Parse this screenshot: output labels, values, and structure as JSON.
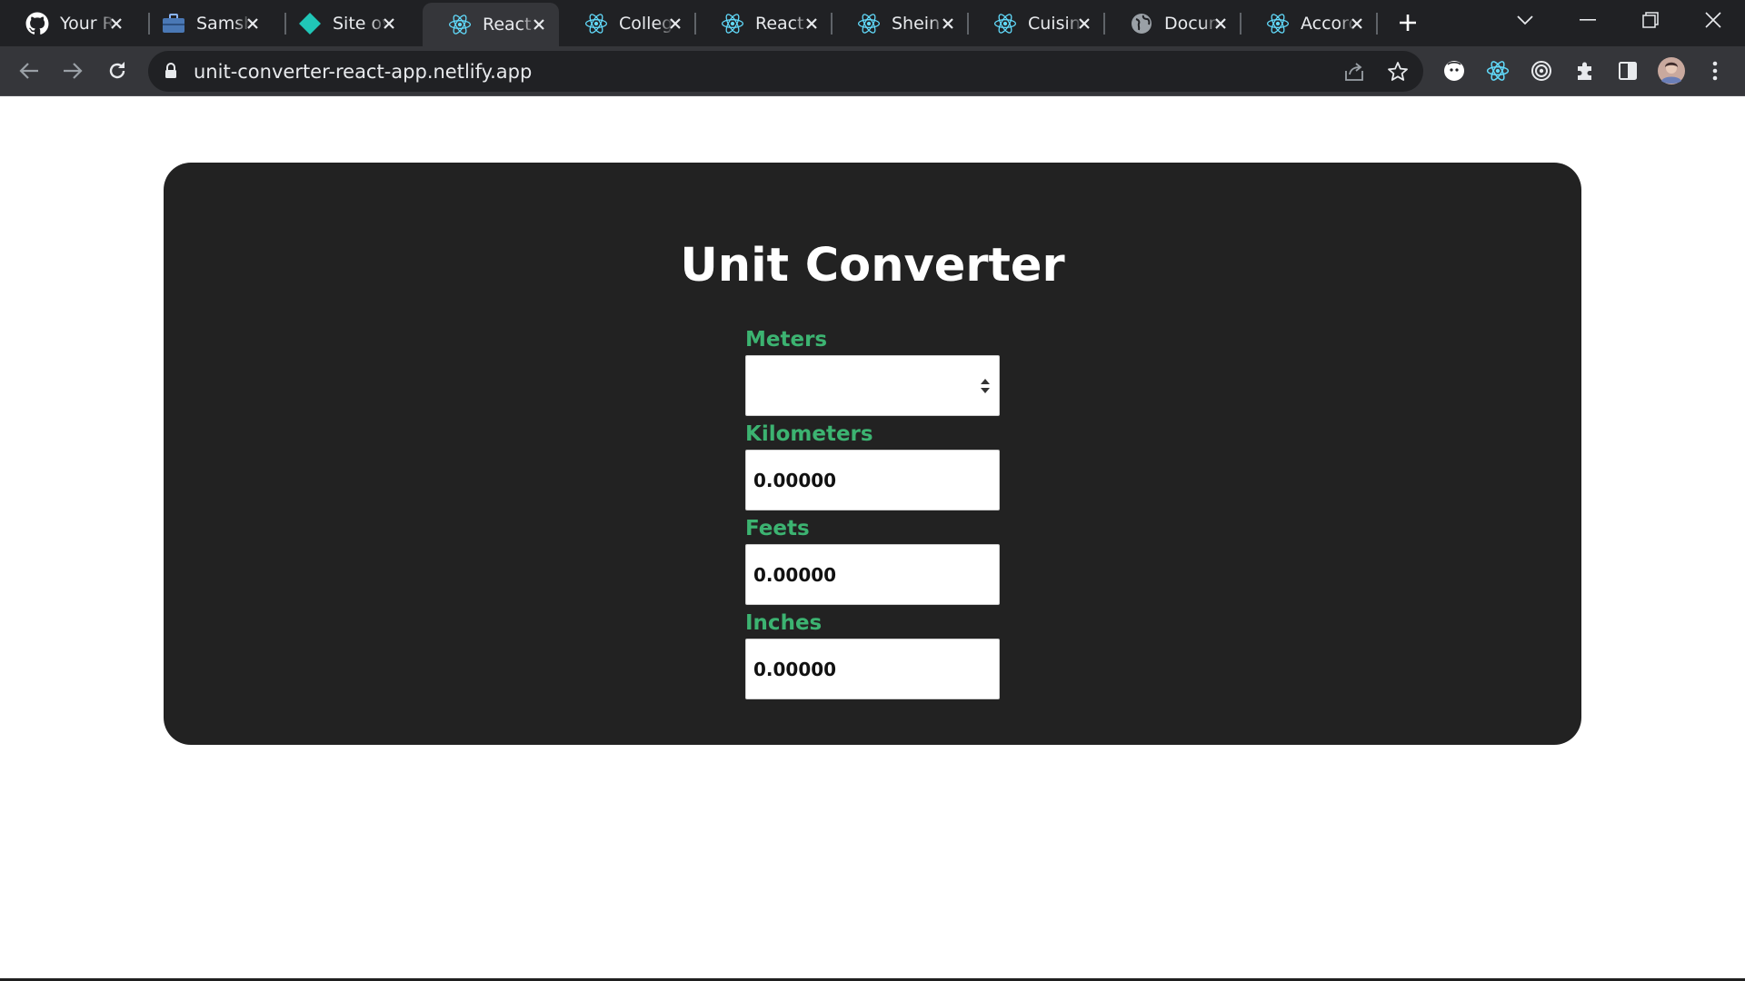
{
  "browser": {
    "tabs": [
      {
        "title": "Your Repositories",
        "icon": "github-icon"
      },
      {
        "title": "Samsher",
        "icon": "briefcase-icon"
      },
      {
        "title": "Site overview",
        "icon": "netlify-icon"
      },
      {
        "title": "React App",
        "icon": "react-icon",
        "active": true
      },
      {
        "title": "College",
        "icon": "react-icon"
      },
      {
        "title": "React App",
        "icon": "react-icon"
      },
      {
        "title": "Shein Clone",
        "icon": "react-icon"
      },
      {
        "title": "Cuisine",
        "icon": "react-icon"
      },
      {
        "title": "Document",
        "icon": "globe-icon"
      },
      {
        "title": "Accordion",
        "icon": "react-icon"
      }
    ],
    "url": "unit-converter-react-app.netlify.app",
    "colors": {
      "tabstrip": "#202124",
      "toolbar": "#35363a",
      "accent_react": "#61dafb"
    }
  },
  "app": {
    "title": "Unit Converter",
    "fields": [
      {
        "label": "Meters",
        "value": "",
        "type": "number"
      },
      {
        "label": "Kilometers",
        "value": "0.00000"
      },
      {
        "label": "Feets",
        "value": "0.00000"
      },
      {
        "label": "Inches",
        "value": "0.00000"
      }
    ],
    "colors": {
      "card": "#222222",
      "label": "#3cb371",
      "title": "#ffffff"
    }
  }
}
